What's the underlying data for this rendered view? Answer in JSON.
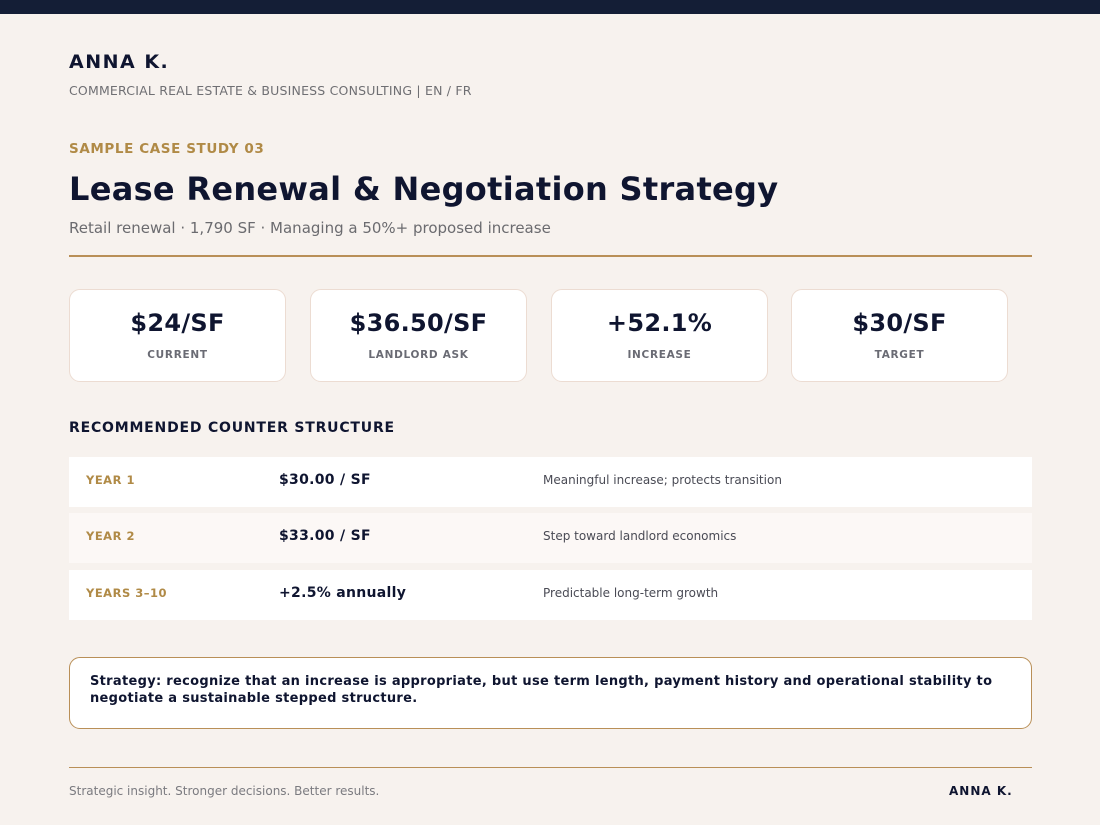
{
  "header": {
    "brand": "ANNA K.",
    "tagline": "COMMERCIAL REAL ESTATE & BUSINESS CONSULTING  |  EN / FR"
  },
  "case": {
    "kicker": "SAMPLE CASE STUDY 03",
    "title": "Lease Renewal & Negotiation Strategy",
    "subtitle": "Retail renewal · 1,790 SF · Managing a 50%+ proposed increase"
  },
  "stats": [
    {
      "value": "$24/SF",
      "label": "CURRENT"
    },
    {
      "value": "$36.50/SF",
      "label": "LANDLORD ASK"
    },
    {
      "value": "+52.1%",
      "label": "INCREASE"
    },
    {
      "value": "$30/SF",
      "label": "TARGET"
    }
  ],
  "counter": {
    "title": "RECOMMENDED COUNTER STRUCTURE",
    "rows": [
      {
        "period": "YEAR 1",
        "rate": "$30.00 / SF",
        "note": "Meaningful increase; protects transition"
      },
      {
        "period": "YEAR 2",
        "rate": "$33.00 / SF",
        "note": "Step toward landlord economics"
      },
      {
        "period": "YEARS 3–10",
        "rate": "+2.5% annually",
        "note": "Predictable long-term growth"
      }
    ]
  },
  "strategy": {
    "text": "Strategy: recognize that an increase is appropriate, but use term length, payment history and operational stability to negotiate a sustainable stepped structure."
  },
  "footer": {
    "slogan": "Strategic insight. Stronger decisions. Better results.",
    "brand": "ANNA K."
  },
  "colors": {
    "background": "#f7f2ee",
    "navy": "#141e36",
    "accent_gold": "#b08a46"
  }
}
